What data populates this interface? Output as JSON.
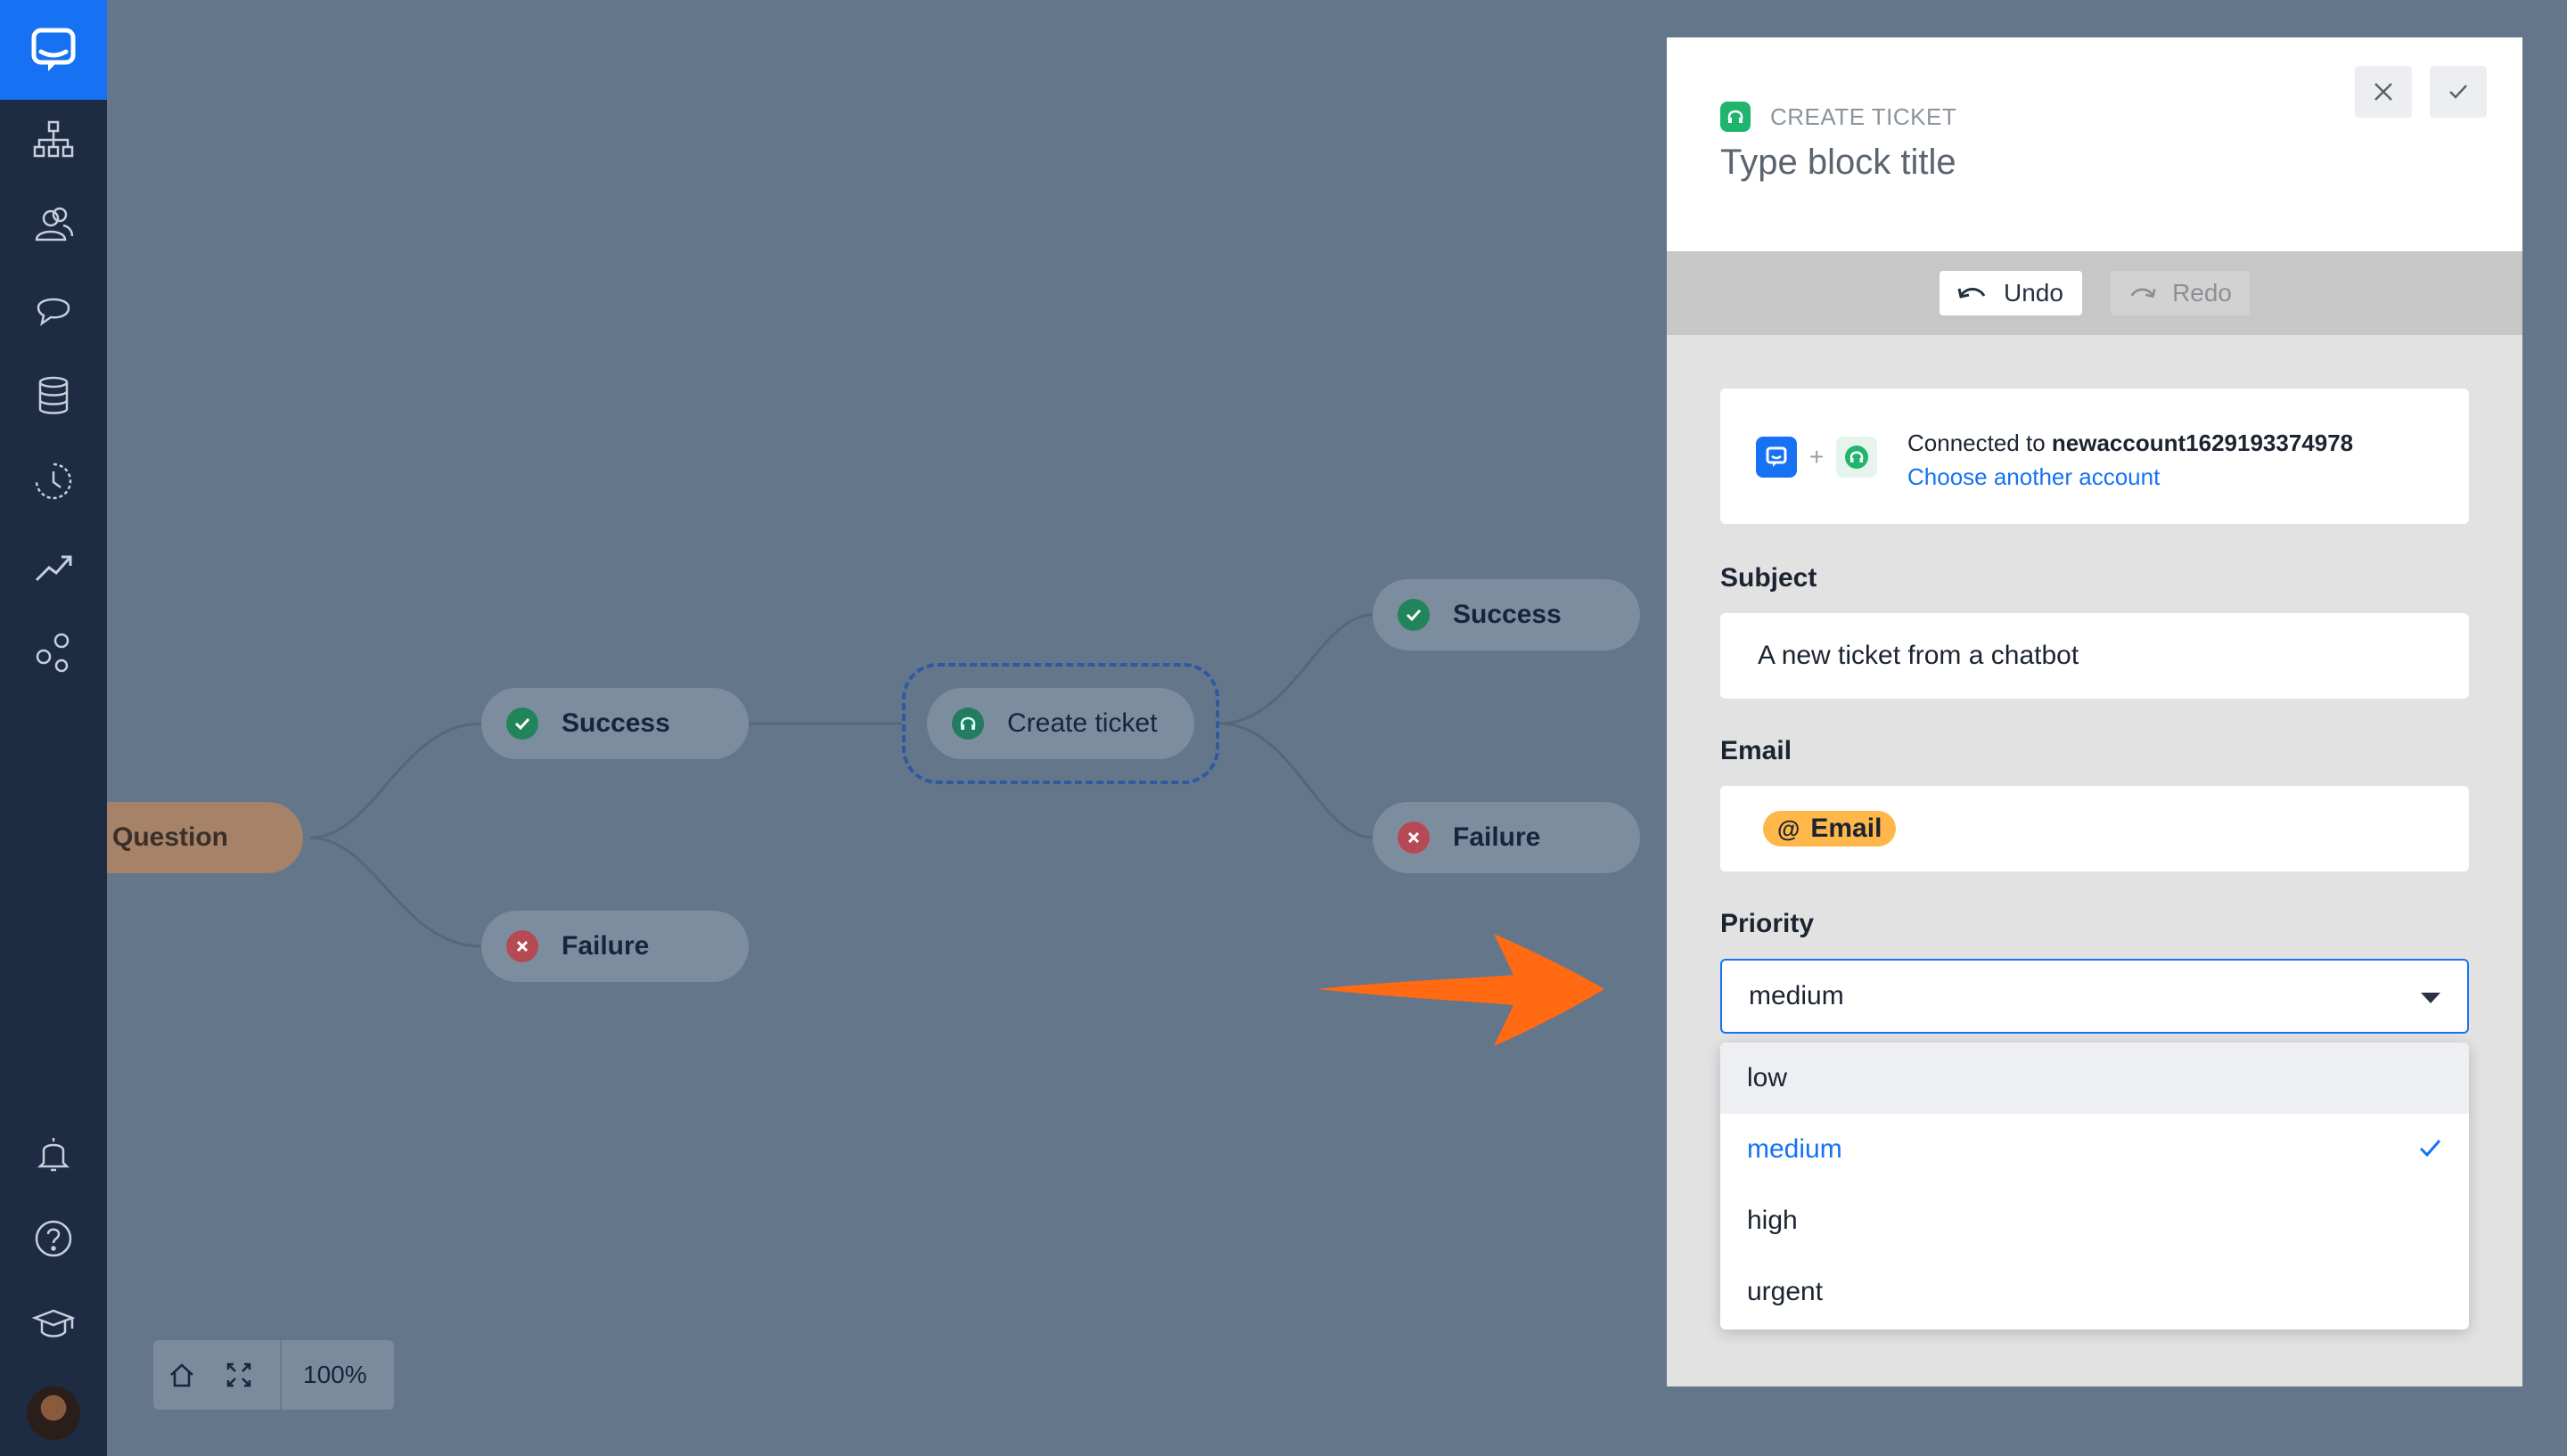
{
  "sidebar": {
    "items": [
      {
        "icon": "flow-icon"
      },
      {
        "icon": "users-icon"
      },
      {
        "icon": "chat-icon"
      },
      {
        "icon": "database-icon"
      },
      {
        "icon": "history-icon"
      },
      {
        "icon": "reports-icon"
      },
      {
        "icon": "integrations-icon"
      }
    ],
    "bottom": [
      {
        "icon": "bell-icon"
      },
      {
        "icon": "help-icon"
      },
      {
        "icon": "academy-icon"
      }
    ]
  },
  "canvas": {
    "question_node": "Question",
    "nodes": {
      "success_left": "Success",
      "failure_left": "Failure",
      "create_ticket": "Create ticket",
      "success_right": "Success",
      "failure_right": "Failure"
    },
    "zoom_level": "100%"
  },
  "panel": {
    "block_type": "CREATE TICKET",
    "block_title": "Type block title",
    "undo_label": "Undo",
    "redo_label": "Redo",
    "account": {
      "connected_prefix": "Connected to",
      "account_name": "newaccount1629193374978",
      "plus": "+",
      "choose_link": "Choose another account"
    },
    "subject": {
      "label": "Subject",
      "value": "A new ticket from a chatbot"
    },
    "email": {
      "label": "Email",
      "tag_symbol": "@",
      "tag_label": "Email"
    },
    "priority": {
      "label": "Priority",
      "selected": "medium",
      "options": [
        "low",
        "medium",
        "high",
        "urgent"
      ]
    }
  },
  "colors": {
    "accent": "#1672f3",
    "sidebar": "#1d2b43",
    "canvas": "#64768a",
    "success": "#22845a",
    "failure": "#b64a54",
    "email_tag": "#ffb74a",
    "annotation_arrow": "#ff6a13"
  }
}
